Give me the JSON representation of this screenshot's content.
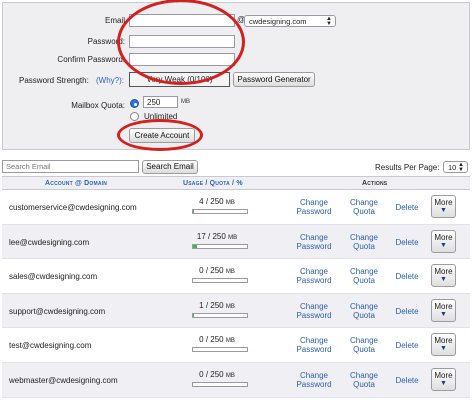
{
  "form": {
    "email_label": "Email",
    "at_symbol": "@",
    "domain_select": "cwdesigning.com",
    "password_label": "Password:",
    "confirm_label": "Confirm Password:",
    "strength_label": "Password Strength:",
    "why_link": "(Why?):",
    "strength_value": "Very Weak (0/100)",
    "generator_button": "Password Generator",
    "quota_label": "Mailbox Quota:",
    "quota_value": "250",
    "quota_unit": "MB",
    "unlimited_label": "Unlimited",
    "create_button": "Create Account"
  },
  "search": {
    "placeholder": "Search Email",
    "button": "Search Email",
    "per_page_label": "Results Per Page:",
    "per_page_value": "10"
  },
  "table": {
    "headers": {
      "account": "Account @ Domain",
      "usage": "Usage / Quota / %",
      "actions": "Actions"
    },
    "actions": {
      "change_password_1": "Change",
      "change_password_2": "Password",
      "change_quota_1": "Change",
      "change_quota_2": "Quota",
      "delete": "Delete",
      "more": "More"
    },
    "rows": [
      {
        "account": "customerservice@cwdesigning.com",
        "used": "4",
        "quota": "250",
        "unit": "MB",
        "fill": 0.016
      },
      {
        "account": "lee@cwdesigning.com",
        "used": "17",
        "quota": "250",
        "unit": "MB",
        "fill": 0.068
      },
      {
        "account": "sales@cwdesigning.com",
        "used": "0",
        "quota": "250",
        "unit": "MB",
        "fill": 0
      },
      {
        "account": "support@cwdesigning.com",
        "used": "1",
        "quota": "250",
        "unit": "MB",
        "fill": 0.004
      },
      {
        "account": "test@cwdesigning.com",
        "used": "0",
        "quota": "250",
        "unit": "MB",
        "fill": 0
      },
      {
        "account": "webmaster@cwdesigning.com",
        "used": "0",
        "quota": "250",
        "unit": "MB",
        "fill": 0
      }
    ]
  },
  "colors": {
    "link": "#2b5fa8",
    "highlight_oval": "#d4201e",
    "usage_fill": "#3dbb3d"
  }
}
